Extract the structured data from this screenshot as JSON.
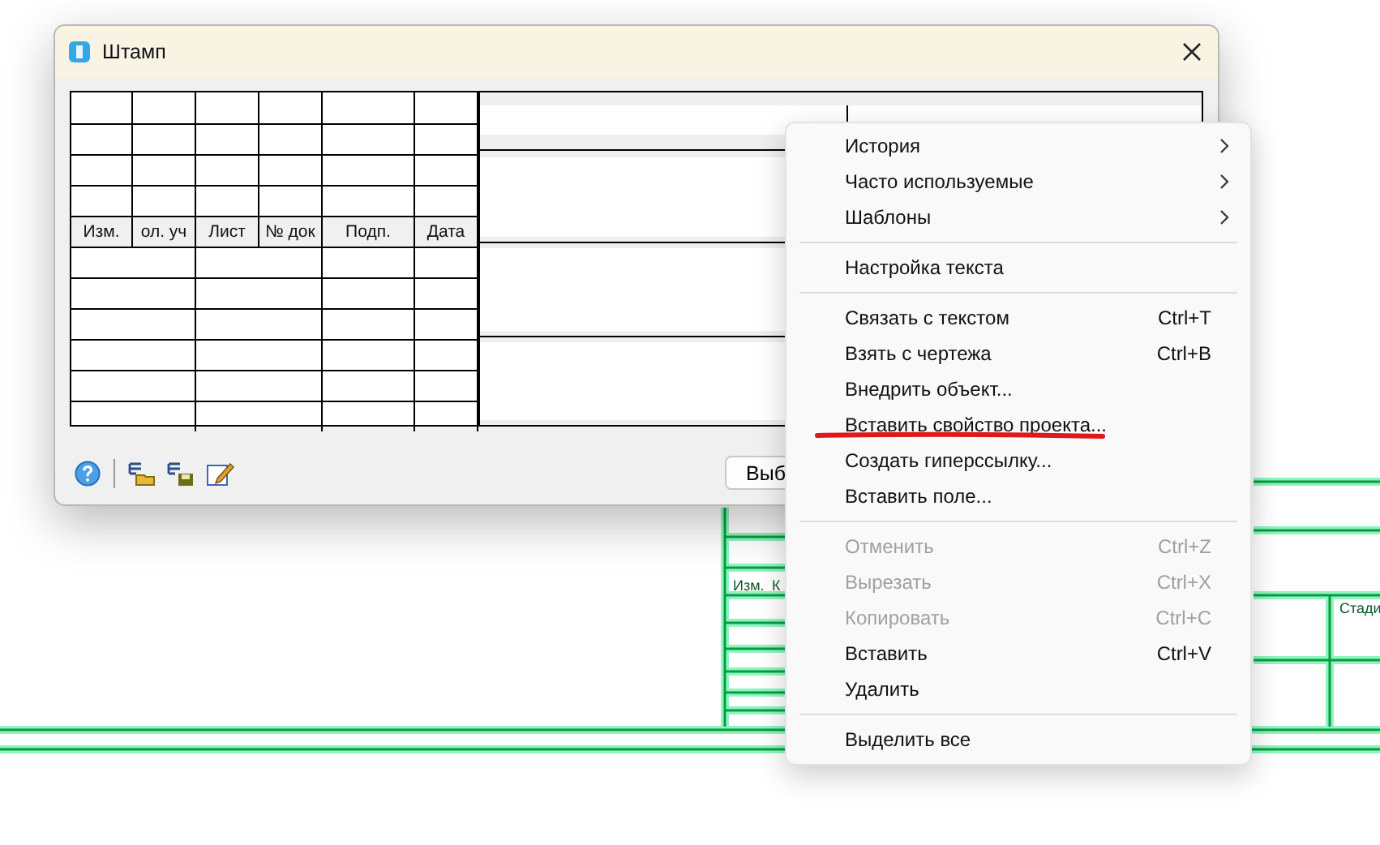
{
  "window": {
    "title": "Штамп"
  },
  "stamp": {
    "columns": [
      "Изм.",
      "ол. уч",
      "Лист",
      "№ док",
      "Подп.",
      "Дата"
    ]
  },
  "footer": {
    "button": "Выб"
  },
  "menu": {
    "items": [
      {
        "kind": "item",
        "label": "История",
        "submenu": true,
        "disabled": false,
        "underlined": false
      },
      {
        "kind": "item",
        "label": "Часто используемые",
        "submenu": true,
        "disabled": false,
        "underlined": false
      },
      {
        "kind": "item",
        "label": "Шаблоны",
        "submenu": true,
        "disabled": false,
        "underlined": false
      },
      {
        "kind": "separator"
      },
      {
        "kind": "item",
        "label": "Настройка текста",
        "submenu": false,
        "disabled": false,
        "underlined": false
      },
      {
        "kind": "separator"
      },
      {
        "kind": "item",
        "label": "Связать с текстом",
        "shortcut": "Ctrl+T",
        "submenu": false,
        "disabled": false,
        "underlined": false
      },
      {
        "kind": "item",
        "label": "Взять с чертежа",
        "shortcut": "Ctrl+B",
        "submenu": false,
        "disabled": false,
        "underlined": false
      },
      {
        "kind": "item",
        "label": "Внедрить объект...",
        "submenu": false,
        "disabled": false,
        "underlined": false
      },
      {
        "kind": "item",
        "label": "Вставить свойство проекта...",
        "submenu": false,
        "disabled": false,
        "underlined": true
      },
      {
        "kind": "item",
        "label": "Создать гиперссылку...",
        "submenu": false,
        "disabled": false,
        "underlined": false
      },
      {
        "kind": "item",
        "label": "Вставить поле...",
        "submenu": false,
        "disabled": false,
        "underlined": false
      },
      {
        "kind": "separator"
      },
      {
        "kind": "item",
        "label": "Отменить",
        "shortcut": "Ctrl+Z",
        "submenu": false,
        "disabled": true,
        "underlined": false
      },
      {
        "kind": "item",
        "label": "Вырезать",
        "shortcut": "Ctrl+X",
        "submenu": false,
        "disabled": true,
        "underlined": false
      },
      {
        "kind": "item",
        "label": "Копировать",
        "shortcut": "Ctrl+C",
        "submenu": false,
        "disabled": true,
        "underlined": false
      },
      {
        "kind": "item",
        "label": "Вставить",
        "shortcut": "Ctrl+V",
        "submenu": false,
        "disabled": false,
        "underlined": false
      },
      {
        "kind": "item",
        "label": "Удалить",
        "submenu": false,
        "disabled": false,
        "underlined": false
      },
      {
        "kind": "separator"
      },
      {
        "kind": "item",
        "label": "Выделить все",
        "submenu": false,
        "disabled": false,
        "underlined": false
      }
    ]
  },
  "drawing": {
    "labels": [
      "Изм.",
      "К",
      "Стади"
    ]
  }
}
